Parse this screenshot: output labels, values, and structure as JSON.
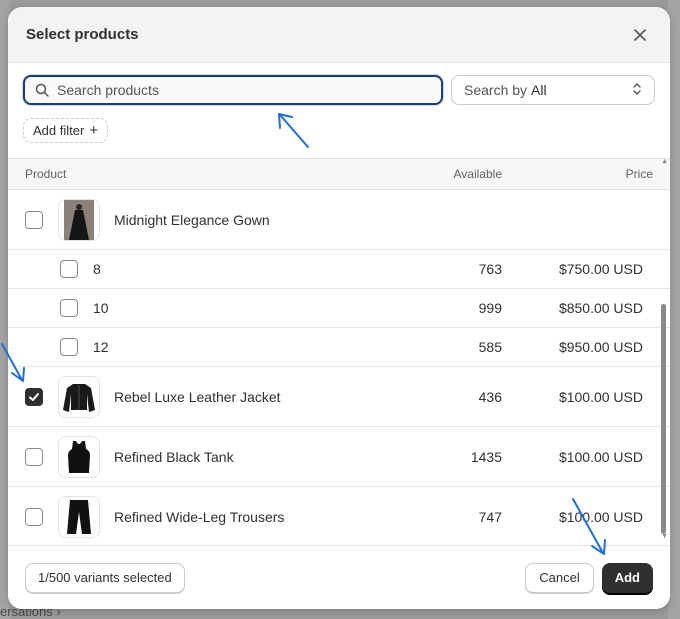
{
  "modal": {
    "title": "Select products",
    "close_icon": "close-icon"
  },
  "search": {
    "placeholder": "Search products",
    "value": "",
    "by_label": "Search by",
    "by_value": "All"
  },
  "filter": {
    "add_filter_label": "Add filter",
    "plus": "+"
  },
  "table": {
    "headers": {
      "product": "Product",
      "available": "Available",
      "price": "Price"
    },
    "rows": [
      {
        "type": "product",
        "name": "Midnight Elegance Gown",
        "available": "",
        "price": "",
        "checked": false
      },
      {
        "type": "variant",
        "name": "8",
        "available": "763",
        "price": "$750.00 USD",
        "checked": false
      },
      {
        "type": "variant",
        "name": "10",
        "available": "999",
        "price": "$850.00 USD",
        "checked": false
      },
      {
        "type": "variant",
        "name": "12",
        "available": "585",
        "price": "$950.00 USD",
        "checked": false
      },
      {
        "type": "product",
        "name": "Rebel Luxe Leather Jacket",
        "available": "436",
        "price": "$100.00 USD",
        "checked": true
      },
      {
        "type": "product",
        "name": "Refined Black Tank",
        "available": "1435",
        "price": "$100.00 USD",
        "checked": false
      },
      {
        "type": "product",
        "name": "Refined Wide-Leg Trousers",
        "available": "747",
        "price": "$100.00 USD",
        "checked": false
      }
    ]
  },
  "footer": {
    "variants_selected": "1/500 variants selected",
    "cancel": "Cancel",
    "add": "Add"
  },
  "background": {
    "bottom_text": "ersations ›"
  },
  "colors": {
    "accent_focus": "#1a3f7a",
    "annotation_arrow": "#1f6fd6",
    "primary_button": "#303030"
  }
}
